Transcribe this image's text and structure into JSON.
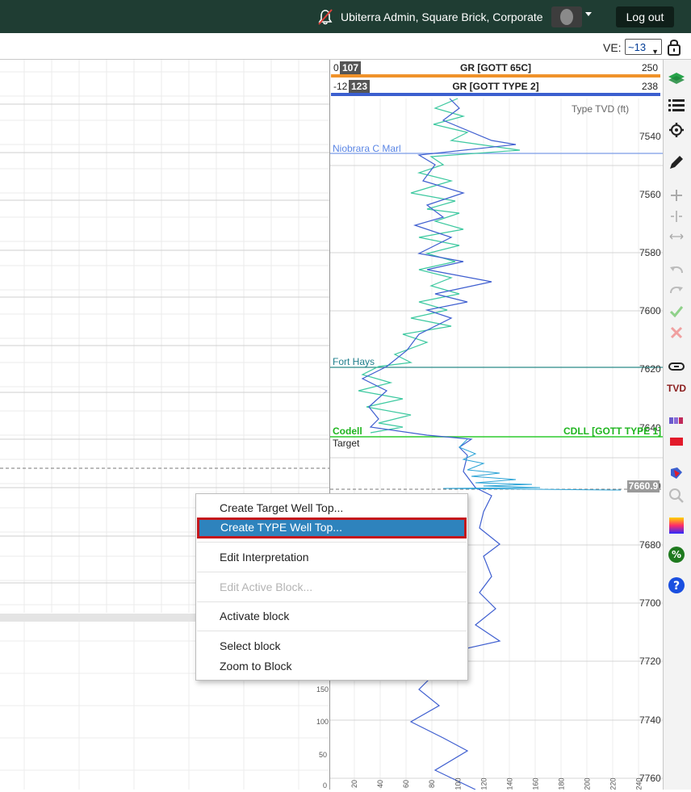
{
  "header": {
    "user_label": "Ubiterra Admin, Square Brick, Corporate",
    "logout_label": "Log out"
  },
  "toolbar": {
    "ve_label": "VE:",
    "ve_value": "~13"
  },
  "tracks": [
    {
      "low": "0",
      "badge": "107",
      "name": "GR [GOTT 65C]",
      "high": "250",
      "color": "#f0922a"
    },
    {
      "low": "-12",
      "badge": "123",
      "name": "GR [GOTT TYPE 2]",
      "high": "238",
      "color": "#3b5fcf"
    }
  ],
  "axis": {
    "type_tvd_label": "Type TVD (ft)",
    "depth_ticks": [
      "7540",
      "7560",
      "7580",
      "7600",
      "7620",
      "7640",
      "7660",
      "7680",
      "7700",
      "7720",
      "7740",
      "7760"
    ],
    "bottom_ticks": [
      "20",
      "40",
      "60",
      "80",
      "100",
      "120",
      "140",
      "160",
      "180",
      "200",
      "220",
      "240"
    ],
    "left_ticks": [
      "150",
      "100",
      "50",
      "0"
    ]
  },
  "formation_tops": {
    "niobrara": "Niobrara C Marl",
    "fort_hays": "Fort Hays",
    "codell": "Codell",
    "target": "Target",
    "cdll": "CDLL [GOTT TYPE 1]"
  },
  "marker_value": "7660.9",
  "context_menu": {
    "create_target": "Create Target Well Top...",
    "create_type": "Create TYPE Well Top...",
    "edit_interpretation": "Edit Interpretation",
    "edit_active_block": "Edit Active Block...",
    "activate_block": "Activate block",
    "select_block": "Select block",
    "zoom_to_block": "Zoom to Block"
  },
  "tools": [
    "layers-icon",
    "list-icon",
    "gear-icon",
    "pencil-icon",
    "plus-icon",
    "split-icon",
    "stretch-icon",
    "undo-icon",
    "redo-icon",
    "check-icon",
    "close-icon",
    "link-icon",
    "tvd-icon",
    "columns-icon",
    "rectangle-icon",
    "fault-icon",
    "magnifier-icon",
    "gradient-icon",
    "percent-icon",
    "help-icon"
  ],
  "tvd_badge": "TVD"
}
